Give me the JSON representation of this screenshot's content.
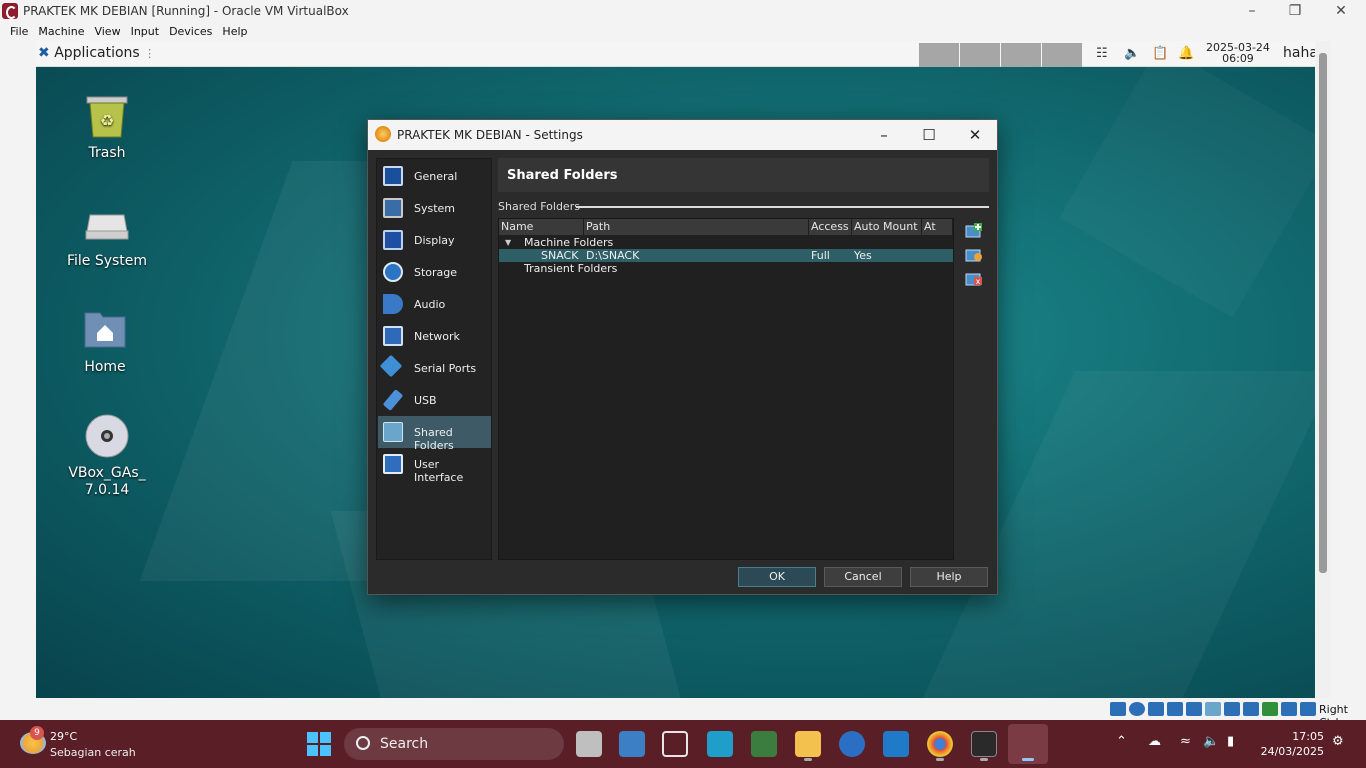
{
  "host": {
    "title": "PRAKTEK MK DEBIAN [Running] - Oracle VM VirtualBox",
    "menu": [
      "File",
      "Machine",
      "View",
      "Input",
      "Devices",
      "Help"
    ],
    "right_ctrl": "Right Ctrl"
  },
  "guest_panel": {
    "applications": "Applications",
    "date": "2025-03-24",
    "time": "06:09",
    "user": "haha"
  },
  "desktop_icons": [
    {
      "label": "Trash",
      "icon": "trash-icon"
    },
    {
      "label": "File System",
      "icon": "drive-icon"
    },
    {
      "label": "Home",
      "icon": "home-folder-icon"
    },
    {
      "label": "VBox_GAs_7.0.14",
      "icon": "cd-icon"
    }
  ],
  "dialog": {
    "title": "PRAKTEK MK DEBIAN - Settings",
    "nav": [
      "General",
      "System",
      "Display",
      "Storage",
      "Audio",
      "Network",
      "Serial Ports",
      "USB",
      "Shared Folders",
      "User Interface"
    ],
    "selected_nav": "Shared Folders",
    "section_title": "Shared Folders",
    "group_label": "Shared Folders",
    "columns": [
      "Name",
      "Path",
      "Access",
      "Auto Mount",
      "At"
    ],
    "machine_folders": "Machine Folders",
    "row": {
      "name": "SNACK",
      "path": "D:\\SNACK",
      "access": "Full",
      "auto_mount": "Yes"
    },
    "transient_folders": "Transient Folders",
    "buttons": {
      "ok": "OK",
      "cancel": "Cancel",
      "help": "Help"
    }
  },
  "taskbar": {
    "weather_temp": "29°C",
    "weather_cond": "Sebagian cerah",
    "weather_badge": "9",
    "search": "Search",
    "time": "17:05",
    "date": "24/03/2025"
  }
}
